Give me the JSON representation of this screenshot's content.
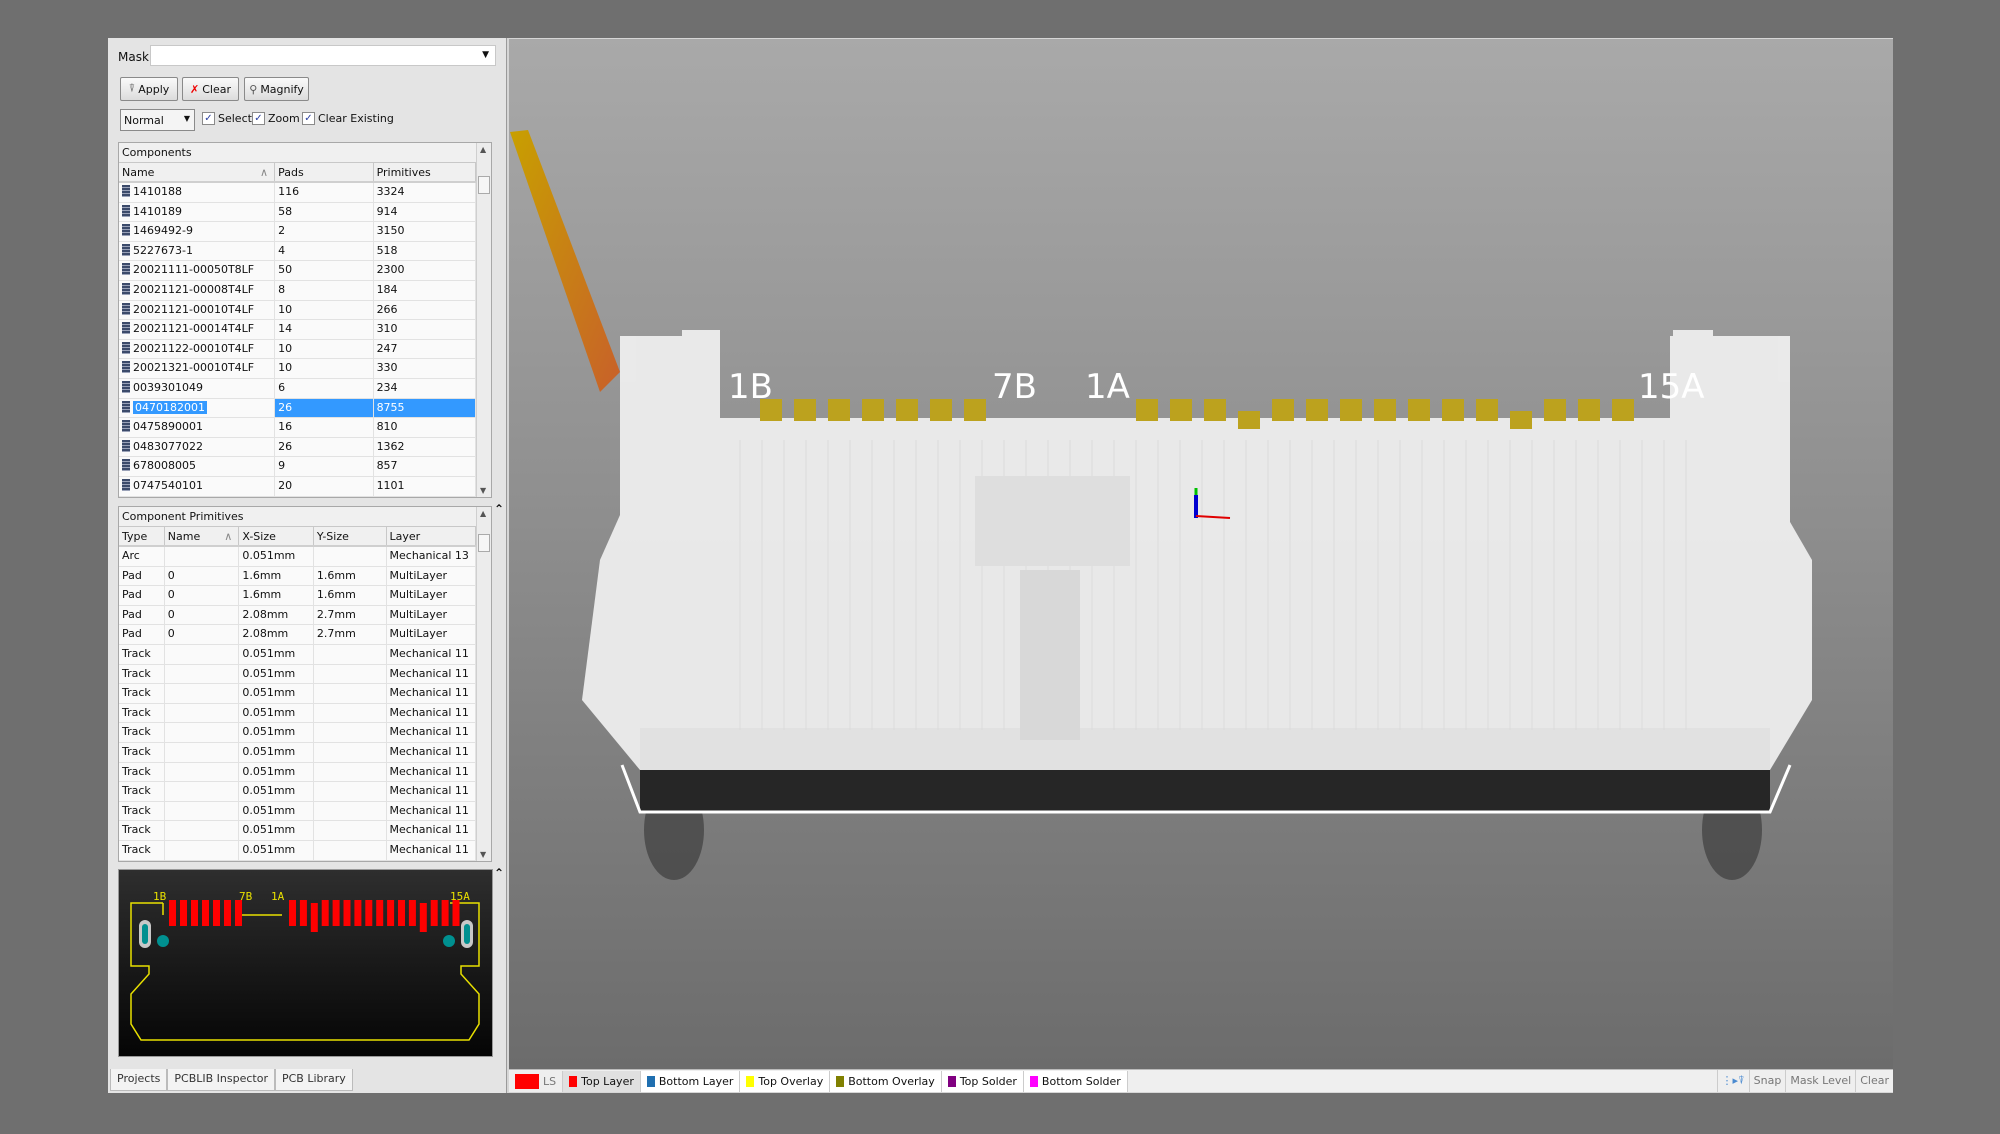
{
  "filter": {
    "mask_label": "Mask",
    "mask_value": "",
    "apply": "Apply",
    "clear": "Clear",
    "magnify": "Magnify",
    "mode": "Normal",
    "select": "Select",
    "zoom": "Zoom",
    "clear_existing": "Clear Existing",
    "select_checked": true,
    "zoom_checked": true,
    "clear_existing_checked": true
  },
  "components": {
    "title": "Components",
    "columns": [
      "Name",
      "Pads",
      "Primitives"
    ],
    "selected_index": 11,
    "rows": [
      [
        "1410188",
        "116",
        "3324"
      ],
      [
        "1410189",
        "58",
        "914"
      ],
      [
        "1469492-9",
        "2",
        "3150"
      ],
      [
        "5227673-1",
        "4",
        "518"
      ],
      [
        "20021111-00050T8LF",
        "50",
        "2300"
      ],
      [
        "20021121-00008T4LF",
        "8",
        "184"
      ],
      [
        "20021121-00010T4LF",
        "10",
        "266"
      ],
      [
        "20021121-00014T4LF",
        "14",
        "310"
      ],
      [
        "20021122-00010T4LF",
        "10",
        "247"
      ],
      [
        "20021321-00010T4LF",
        "10",
        "330"
      ],
      [
        "0039301049",
        "6",
        "234"
      ],
      [
        "0470182001",
        "26",
        "8755"
      ],
      [
        "0475890001",
        "16",
        "810"
      ],
      [
        "0483077022",
        "26",
        "1362"
      ],
      [
        "678008005",
        "9",
        "857"
      ],
      [
        "0747540101",
        "20",
        "1101"
      ]
    ]
  },
  "primitives": {
    "title": "Component Primitives",
    "columns": [
      "Type",
      "Name",
      "X-Size",
      "Y-Size",
      "Layer"
    ],
    "rows": [
      [
        "Arc",
        "",
        "0.051mm",
        "",
        "Mechanical 13"
      ],
      [
        "Pad",
        "0",
        "1.6mm",
        "1.6mm",
        "MultiLayer"
      ],
      [
        "Pad",
        "0",
        "1.6mm",
        "1.6mm",
        "MultiLayer"
      ],
      [
        "Pad",
        "0",
        "2.08mm",
        "2.7mm",
        "MultiLayer"
      ],
      [
        "Pad",
        "0",
        "2.08mm",
        "2.7mm",
        "MultiLayer"
      ],
      [
        "Track",
        "",
        "0.051mm",
        "",
        "Mechanical 11"
      ],
      [
        "Track",
        "",
        "0.051mm",
        "",
        "Mechanical 11"
      ],
      [
        "Track",
        "",
        "0.051mm",
        "",
        "Mechanical 11"
      ],
      [
        "Track",
        "",
        "0.051mm",
        "",
        "Mechanical 11"
      ],
      [
        "Track",
        "",
        "0.051mm",
        "",
        "Mechanical 11"
      ],
      [
        "Track",
        "",
        "0.051mm",
        "",
        "Mechanical 11"
      ],
      [
        "Track",
        "",
        "0.051mm",
        "",
        "Mechanical 11"
      ],
      [
        "Track",
        "",
        "0.051mm",
        "",
        "Mechanical 11"
      ],
      [
        "Track",
        "",
        "0.051mm",
        "",
        "Mechanical 11"
      ],
      [
        "Track",
        "",
        "0.051mm",
        "",
        "Mechanical 11"
      ],
      [
        "Track",
        "",
        "0.051mm",
        "",
        "Mechanical 11"
      ]
    ]
  },
  "preview": {
    "labels": [
      "1B",
      "7B",
      "1A",
      "15A"
    ]
  },
  "view3d": {
    "labels": [
      "1B",
      "7B",
      "1A",
      "15A"
    ]
  },
  "panel_tabs": [
    "Projects",
    "PCBLIB Inspector",
    "PCB Library"
  ],
  "status": {
    "current_layer_indicator": "LS",
    "layers": [
      {
        "name": "Top Layer",
        "color": "#ff0000"
      },
      {
        "name": "Bottom Layer",
        "color": "#1f6fb0"
      },
      {
        "name": "Top Overlay",
        "color": "#ffff00"
      },
      {
        "name": "Bottom Overlay",
        "color": "#808000"
      },
      {
        "name": "Top Solder",
        "color": "#800080"
      },
      {
        "name": "Bottom Solder",
        "color": "#ff00ff"
      }
    ],
    "right": [
      "Snap",
      "Mask Level",
      "Clear"
    ]
  }
}
